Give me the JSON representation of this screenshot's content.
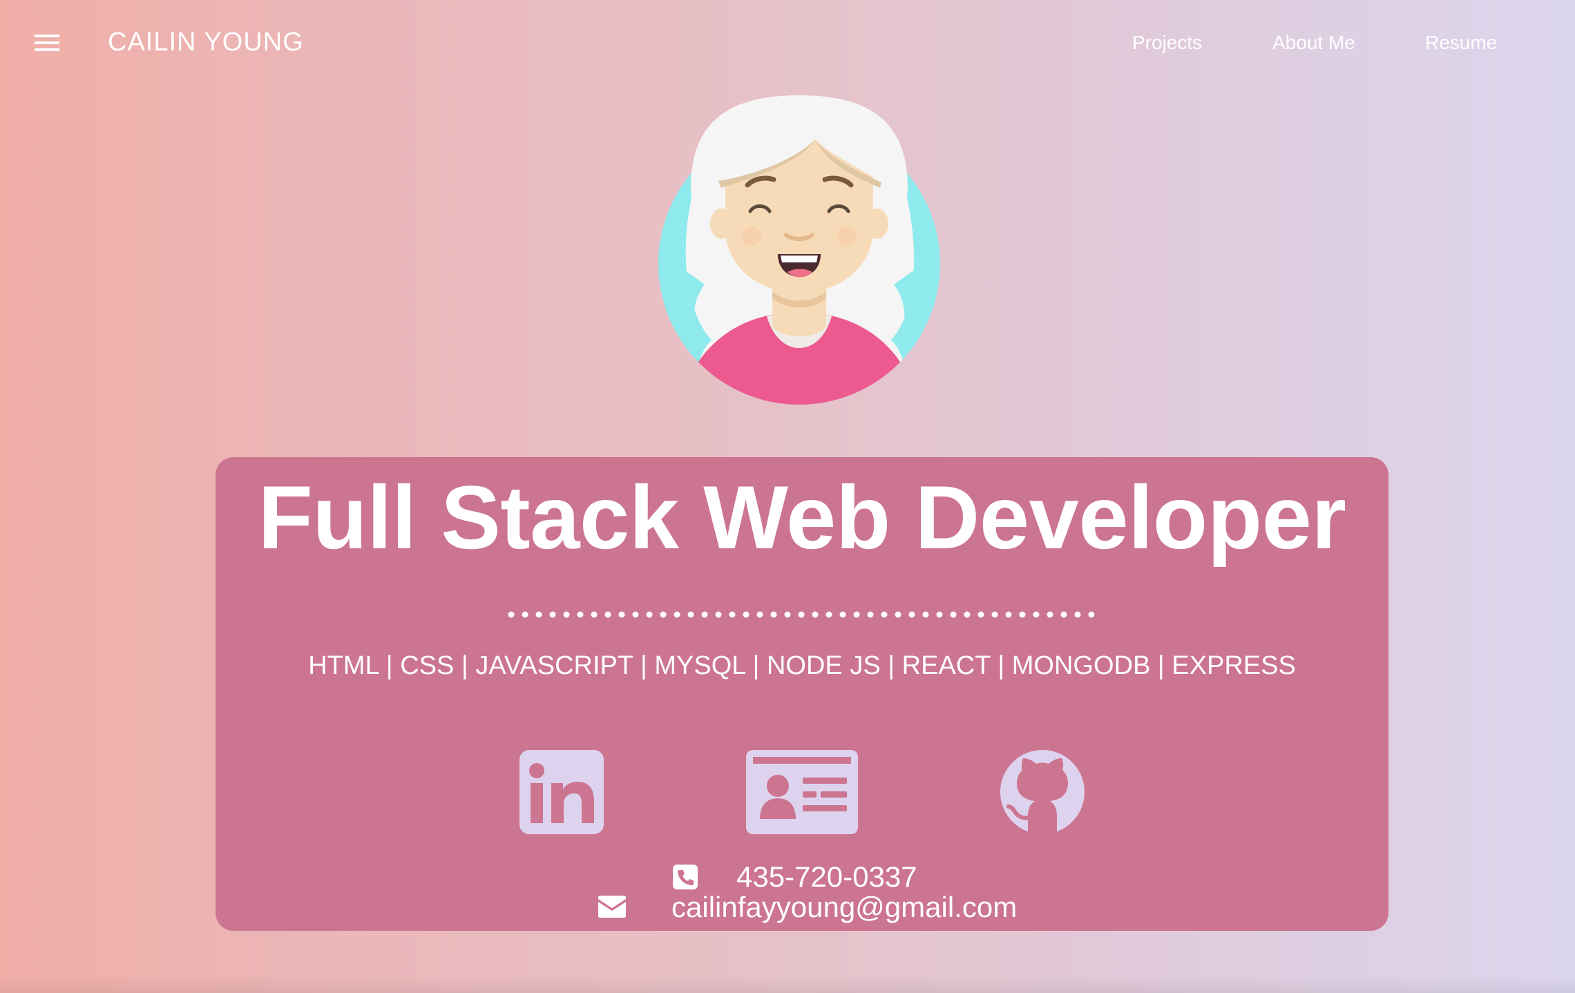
{
  "header": {
    "menu_icon": "hamburger-menu-icon",
    "brand": "CAILIN YOUNG",
    "nav": [
      {
        "label": "Projects"
      },
      {
        "label": "About Me"
      },
      {
        "label": "Resume"
      }
    ]
  },
  "avatar": {
    "icon": "cartoon-avatar-portrait"
  },
  "hero": {
    "title": "Full Stack Web Developer",
    "skills": "HTML | CSS | JAVASCRIPT | MYSQL | NODE JS | REACT | MONGODB | EXPRESS",
    "social_links": [
      {
        "icon": "linkedin-icon"
      },
      {
        "icon": "id-card-icon"
      },
      {
        "icon": "github-icon"
      }
    ],
    "contact": {
      "phone_icon": "phone-icon",
      "phone": "435-720-0337",
      "email_icon": "envelope-icon",
      "email": "cailinfayyoung@gmail.com"
    }
  },
  "colors": {
    "card_background": "#cc7590",
    "icon_lavender": "#ddd3ee",
    "text_white": "#ffffff",
    "sweater_pink": "#ec5a8f",
    "hair_accent": "#8eeaec"
  }
}
